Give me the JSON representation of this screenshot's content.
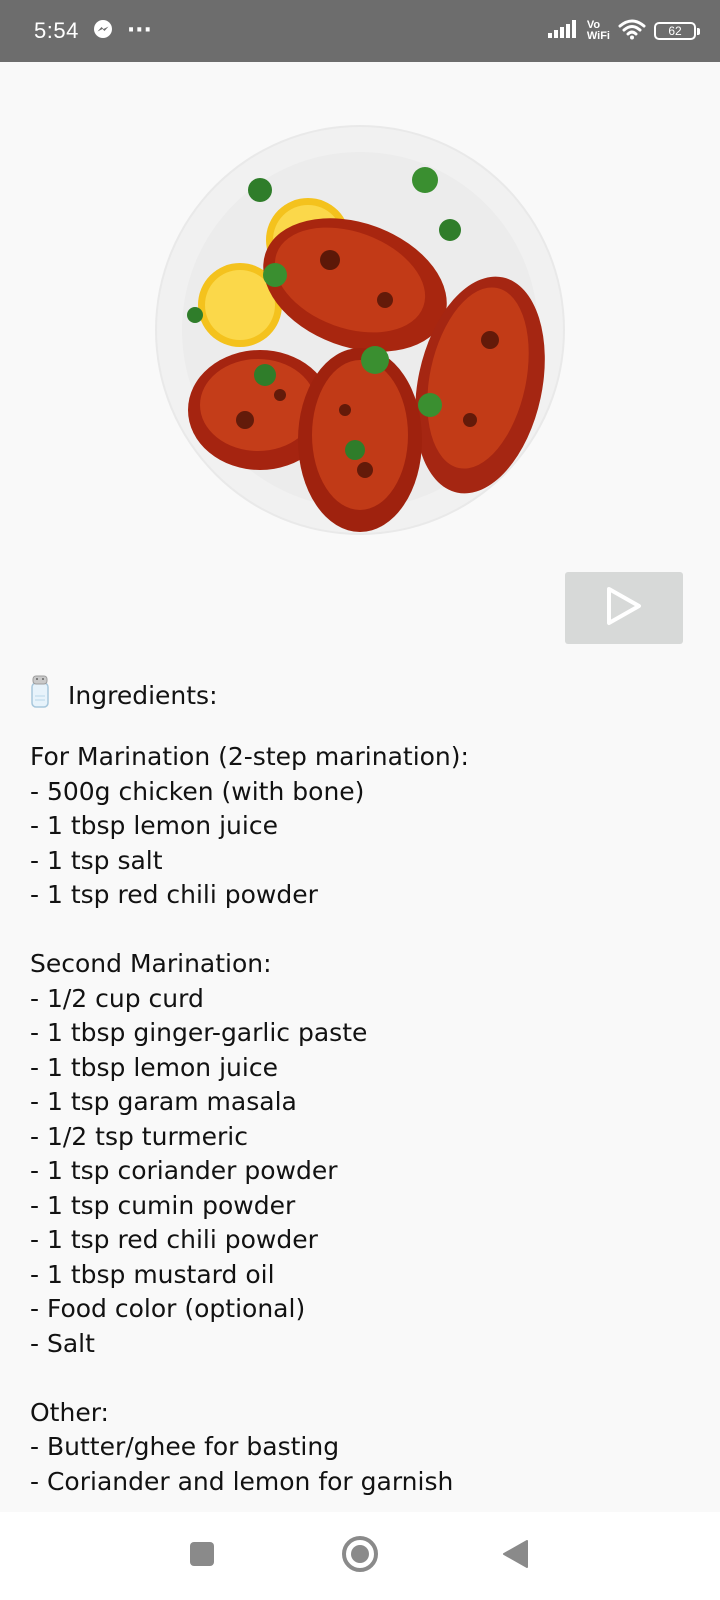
{
  "status_bar": {
    "time": "5:54",
    "overflow_dots": "···",
    "vo_label": "Vo",
    "wifi_label": "WiFi",
    "battery_level": "62"
  },
  "media": {
    "image_icon": "tandoori-chicken-plate-image",
    "play_icon": "play-icon"
  },
  "recipe": {
    "heading_icon": "salt-shaker-icon",
    "heading": "Ingredients:",
    "marination_title": "For Marination (2-step marination):",
    "marination_items": [
      "- 500g chicken (with bone)",
      "- 1 tbsp lemon juice",
      "- 1 tsp salt",
      "- 1 tsp red chili powder"
    ],
    "second_title": "Second Marination:",
    "second_items": [
      "- 1/2 cup curd",
      "- 1 tbsp ginger-garlic paste",
      "- 1 tbsp lemon juice",
      "- 1 tsp garam masala",
      "- 1/2 tsp turmeric",
      "- 1 tsp coriander powder",
      "- 1 tsp cumin powder",
      "- 1 tsp red chili powder",
      "- 1 tbsp mustard oil",
      "- Food color (optional)",
      "- Salt"
    ],
    "other_title": "Other:",
    "other_items": [
      "- Butter/ghee for basting",
      "- Coriander and lemon for garnish"
    ]
  },
  "nav": {
    "recents_icon": "recents-square-icon",
    "home_icon": "home-circle-icon",
    "back_icon": "back-triangle-icon"
  },
  "colors": {
    "status_bar_bg": "#6d6d6d",
    "page_bg": "#f9f9f9",
    "play_button_bg": "#d7d9d8",
    "nav_icon": "#8a8a8a"
  }
}
